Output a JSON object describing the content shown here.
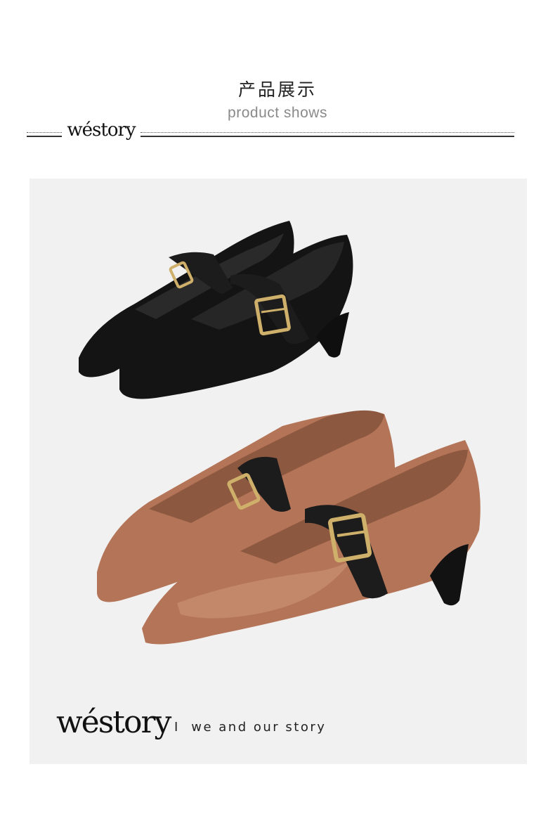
{
  "header": {
    "title_cn": "产品展示",
    "title_en": "product shows",
    "brand": "wéstory"
  },
  "footer": {
    "brand": "wéstory",
    "tagline": "I  we and our story"
  },
  "colors": {
    "panel_background": "#f1f1f1",
    "black_shoe": "#141414",
    "tan_shoe": "#b47458",
    "strap": "#1c1c1c",
    "buckle_gold": "#cfb06a"
  },
  "product_photo": {
    "items": [
      "black-mary-jane-pump",
      "tan-mary-jane-pump"
    ]
  }
}
